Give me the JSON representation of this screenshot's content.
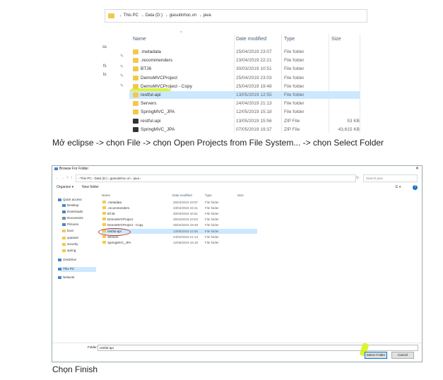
{
  "explorer": {
    "breadcrumb": [
      "This PC",
      "Data (D:)",
      "giasutinhoc.vn",
      "java"
    ],
    "side_fragments": [
      "ss",
      "fs",
      "ts"
    ],
    "columns": {
      "name": "Name",
      "date": "Date modified",
      "type": "Type",
      "size": "Size"
    },
    "rows": [
      {
        "name": ".metadata",
        "date": "25/04/2019 23:07",
        "type": "File folder",
        "size": "",
        "icon": "folder-icon"
      },
      {
        "name": ".recommenders",
        "date": "23/04/2019 22:21",
        "type": "File folder",
        "size": "",
        "icon": "folder-icon"
      },
      {
        "name": "BTJ6",
        "date": "30/03/2019 10:51",
        "type": "File folder",
        "size": "",
        "icon": "folder-icon"
      },
      {
        "name": "DemoMVCProject",
        "date": "25/04/2019 23:03",
        "type": "File folder",
        "size": "",
        "icon": "folder-icon"
      },
      {
        "name": "DemoMVCProject - Copy",
        "date": "25/04/2019 19:48",
        "type": "File folder",
        "size": "",
        "icon": "folder-icon"
      },
      {
        "name": "restful-api",
        "date": "13/05/2019 12:55",
        "type": "File folder",
        "size": "",
        "icon": "folder-icon",
        "selected": true
      },
      {
        "name": "Servers",
        "date": "24/04/2019 21:13",
        "type": "File folder",
        "size": "",
        "icon": "folder-icon"
      },
      {
        "name": "SpringMVC_JPA",
        "date": "12/05/2019 15:18",
        "type": "File folder",
        "size": "",
        "icon": "folder-icon"
      },
      {
        "name": "restful-api",
        "date": "13/05/2019 15:56",
        "type": "ZIP File",
        "size": "53 KB",
        "icon": "zip-icon"
      },
      {
        "name": "SpringMVC_JPA",
        "date": "07/05/2019 19:37",
        "type": "ZIP File",
        "size": "43,615 KB",
        "icon": "zip-icon"
      }
    ]
  },
  "caption1": "Mở eclipse -> chọn File -> chọn Open Projects from File System... -> chọn Select Folder",
  "dialog": {
    "title": "Browse For Folder",
    "close": "✕",
    "breadcrumb": "›  This PC  ›  Data (D:)  ›  giasutinhoc.vn  ›  java  ›",
    "search_placeholder": "Search java",
    "toolbar": {
      "organize": "Organize ▾",
      "new_folder": "New folder"
    },
    "tree": [
      {
        "label": "Quick access",
        "color": "#4a86c7"
      },
      {
        "label": "Desktop",
        "color": "#4a86c7"
      },
      {
        "label": "Downloads",
        "color": "#4a86c7"
      },
      {
        "label": "Documents",
        "color": "#8a8a8a"
      },
      {
        "label": "Pictures",
        "color": "#4a86c7"
      },
      {
        "label": "boot",
        "color": "#f2c94c"
      },
      {
        "label": "quanam",
        "color": "#f2c94c"
      },
      {
        "label": "security",
        "color": "#f2c94c"
      },
      {
        "label": "spring",
        "color": "#f2c94c"
      },
      {
        "label": "OneDrive",
        "color": "#4a86c7"
      },
      {
        "label": "This PC",
        "color": "#4a86c7"
      },
      {
        "label": "Network",
        "color": "#4a86c7"
      }
    ],
    "columns": {
      "name": "Name",
      "date": "Date modified",
      "type": "Type",
      "size": "Size"
    },
    "rows": [
      {
        "name": ".metadata",
        "date": "25/04/2019 23:07",
        "type": "File folder"
      },
      {
        "name": ".recommenders",
        "date": "23/04/2019 22:21",
        "type": "File folder"
      },
      {
        "name": "BTJ6",
        "date": "30/03/2019 10:51",
        "type": "File folder"
      },
      {
        "name": "DemoMVCProject",
        "date": "25/04/2019 23:03",
        "type": "File folder"
      },
      {
        "name": "DemoMVCProject - Copy",
        "date": "25/04/2019 19:48",
        "type": "File folder"
      },
      {
        "name": "restful-api",
        "date": "13/05/2019 12:55",
        "type": "File folder",
        "selected": true
      },
      {
        "name": "Servers",
        "date": "24/04/2019 21:13",
        "type": "File folder"
      },
      {
        "name": "SpringMVC_JPA",
        "date": "12/05/2019 15:18",
        "type": "File folder"
      }
    ],
    "folder_label": "Folder:",
    "folder_value": "restful-api",
    "select_button": "Select Folder",
    "cancel_button": "Cancel"
  },
  "caption2": "Chọn Finish"
}
